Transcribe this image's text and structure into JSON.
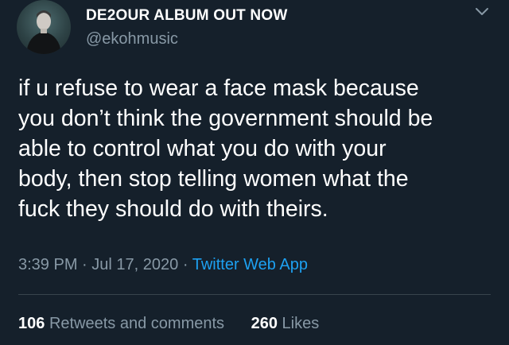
{
  "author": {
    "display_name": "DE2OUR ALBUM OUT NOW",
    "handle": "@ekohmusic",
    "avatar_icon": "user-avatar"
  },
  "menu_icon": "chevron-down-icon",
  "tweet": {
    "lines": [
      "if u refuse to wear a face mask because",
      "you don’t think the government should be",
      "able to control what you do with your",
      "body, then stop telling women what the",
      "fuck they should do with theirs."
    ]
  },
  "meta": {
    "time": "3:39 PM",
    "separator": "·",
    "date": "Jul 17, 2020",
    "source": "Twitter Web App"
  },
  "stats": {
    "retweets_count": "106",
    "retweets_label": "Retweets and comments",
    "likes_count": "260",
    "likes_label": "Likes"
  },
  "colors": {
    "background": "#15202b",
    "text_primary": "#ffffff",
    "text_secondary": "#8899a6",
    "link": "#1da1f2",
    "divider": "#38444d"
  }
}
